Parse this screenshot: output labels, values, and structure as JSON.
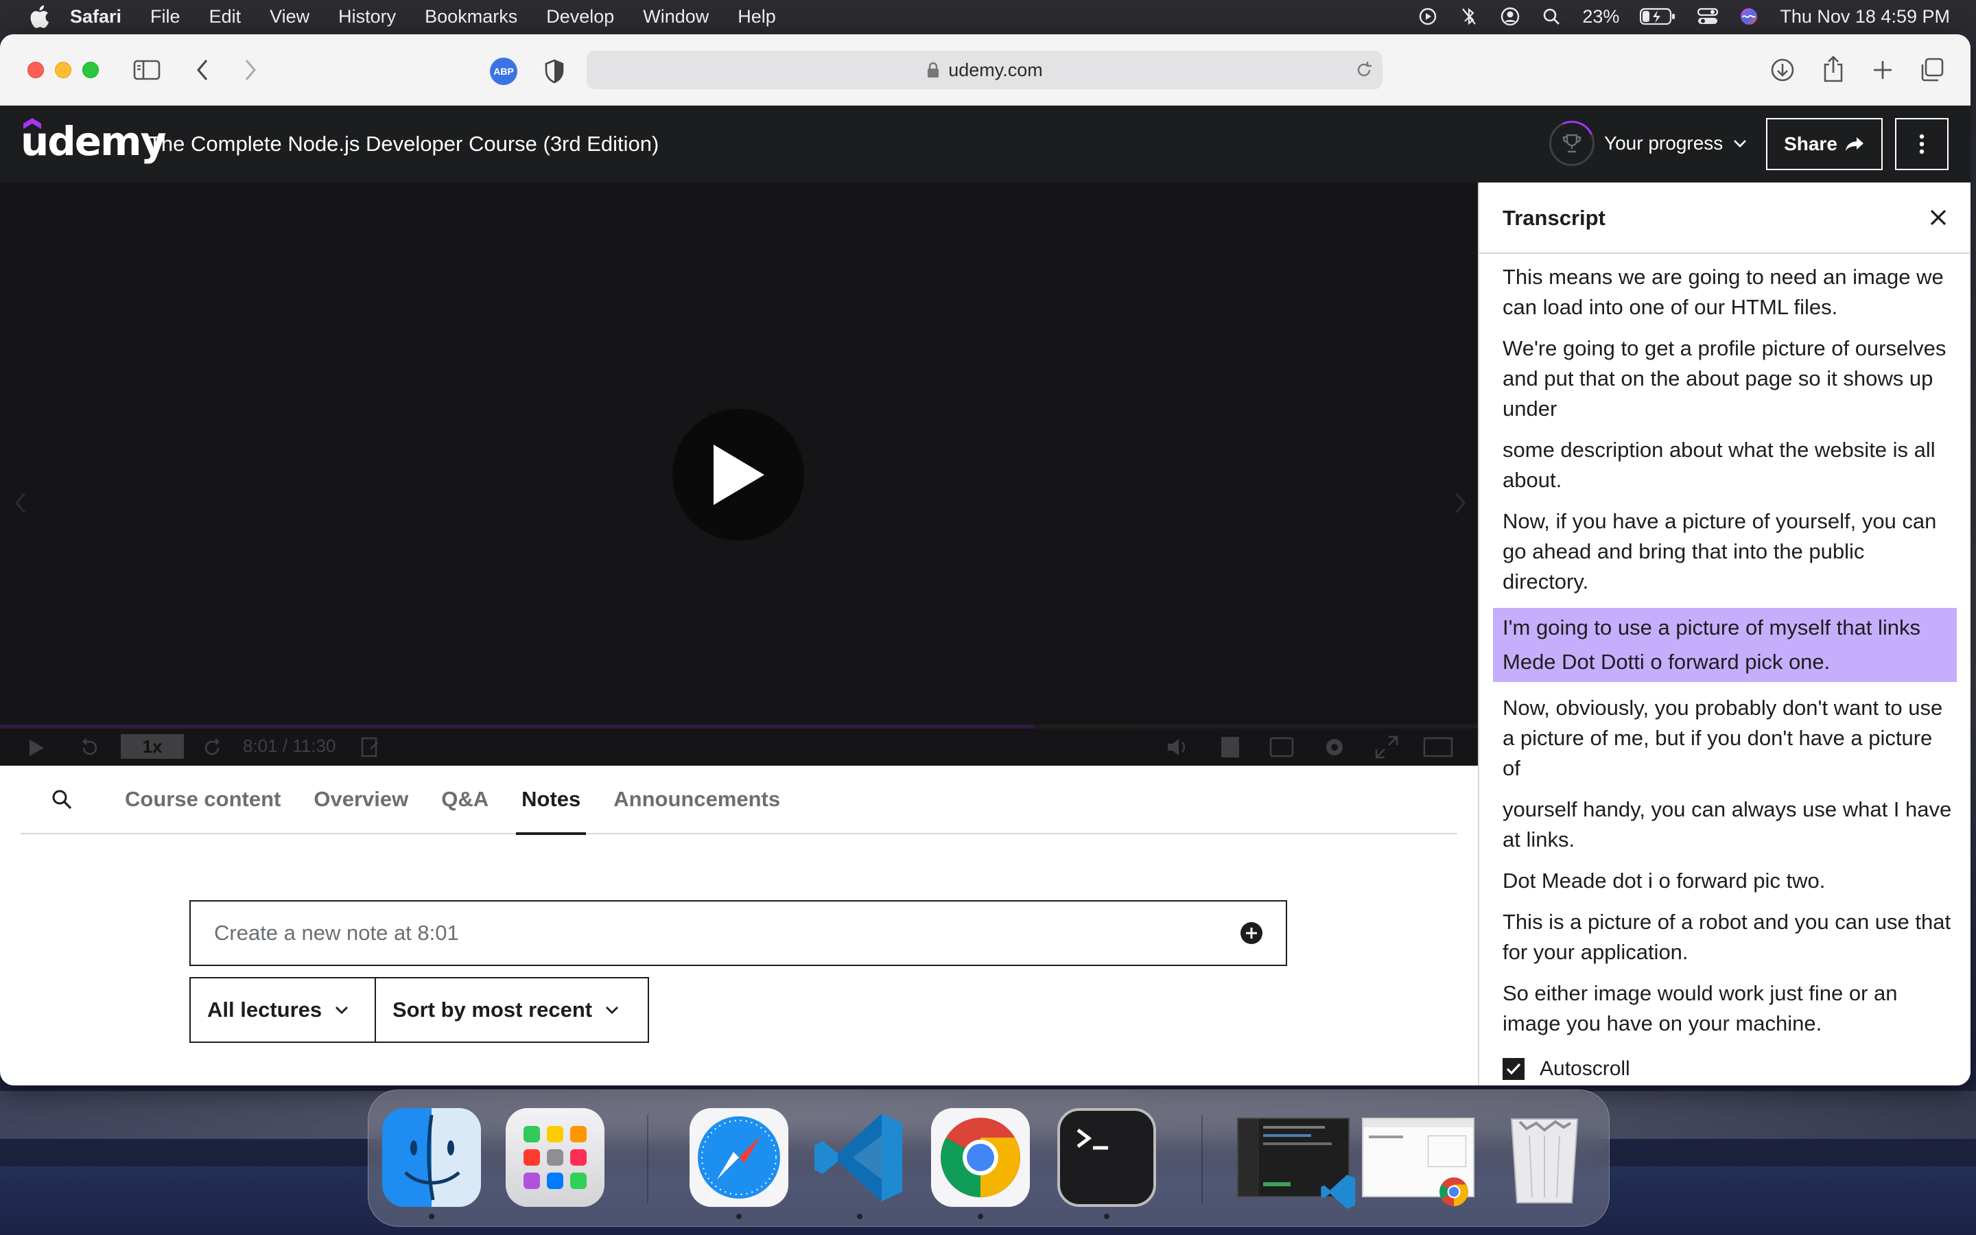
{
  "menubar": {
    "app_name": "Safari",
    "items": [
      "File",
      "Edit",
      "View",
      "History",
      "Bookmarks",
      "Develop",
      "Window",
      "Help"
    ],
    "battery": "23%",
    "datetime": "Thu Nov 18  4:59 PM"
  },
  "browser": {
    "url": "udemy.com",
    "extension_badge": "ABP"
  },
  "header": {
    "logo": "udemy",
    "course_title": "The Complete Node.js Developer Course (3rd Edition)",
    "progress_label": "Your progress",
    "share_label": "Share"
  },
  "player": {
    "time": "8:01 / 11:30",
    "speed": "1x",
    "progress_fraction": 0.7
  },
  "tabs": [
    "Course content",
    "Overview",
    "Q&A",
    "Notes",
    "Announcements"
  ],
  "active_tab": "Notes",
  "notes": {
    "placeholder": "Create a new note at 8:01",
    "filter_label": "All lectures",
    "sort_label": "Sort by most recent"
  },
  "transcript": {
    "title": "Transcript",
    "lines": [
      "This means we are going to need an image we can load into one of our HTML files.",
      "We're going to get a profile picture of ourselves and put that on the about page so it shows up under",
      "some description about what the website is all about.",
      "Now, if you have a picture of yourself, you can go ahead and bring that into the public directory.",
      "I'm going to use a picture of myself that links Mede Dot Dotti o forward pick one.",
      "Now, obviously, you probably don't want to use a picture of me, but if you don't have a picture of",
      "yourself handy, you can always use what I have at links.",
      "Dot Meade dot i o forward pic two.",
      "This is a picture of a robot and you can use that for your application.",
      "So either image would work just fine or an image you have on your machine."
    ],
    "highlighted_index": 4,
    "autoscroll_label": "Autoscroll",
    "autoscroll_checked": true
  },
  "colors": {
    "udemy_dark": "#1c1d1f",
    "udemy_purple": "#a435f0",
    "highlight": "#c5aefb"
  },
  "dock": {
    "apps": [
      "finder-icon",
      "launchpad-icon",
      "safari-icon",
      "vscode-icon",
      "chrome-icon",
      "terminal-icon",
      "vscode-window-thumbnail",
      "chrome-window-thumbnail",
      "trash-icon"
    ]
  }
}
